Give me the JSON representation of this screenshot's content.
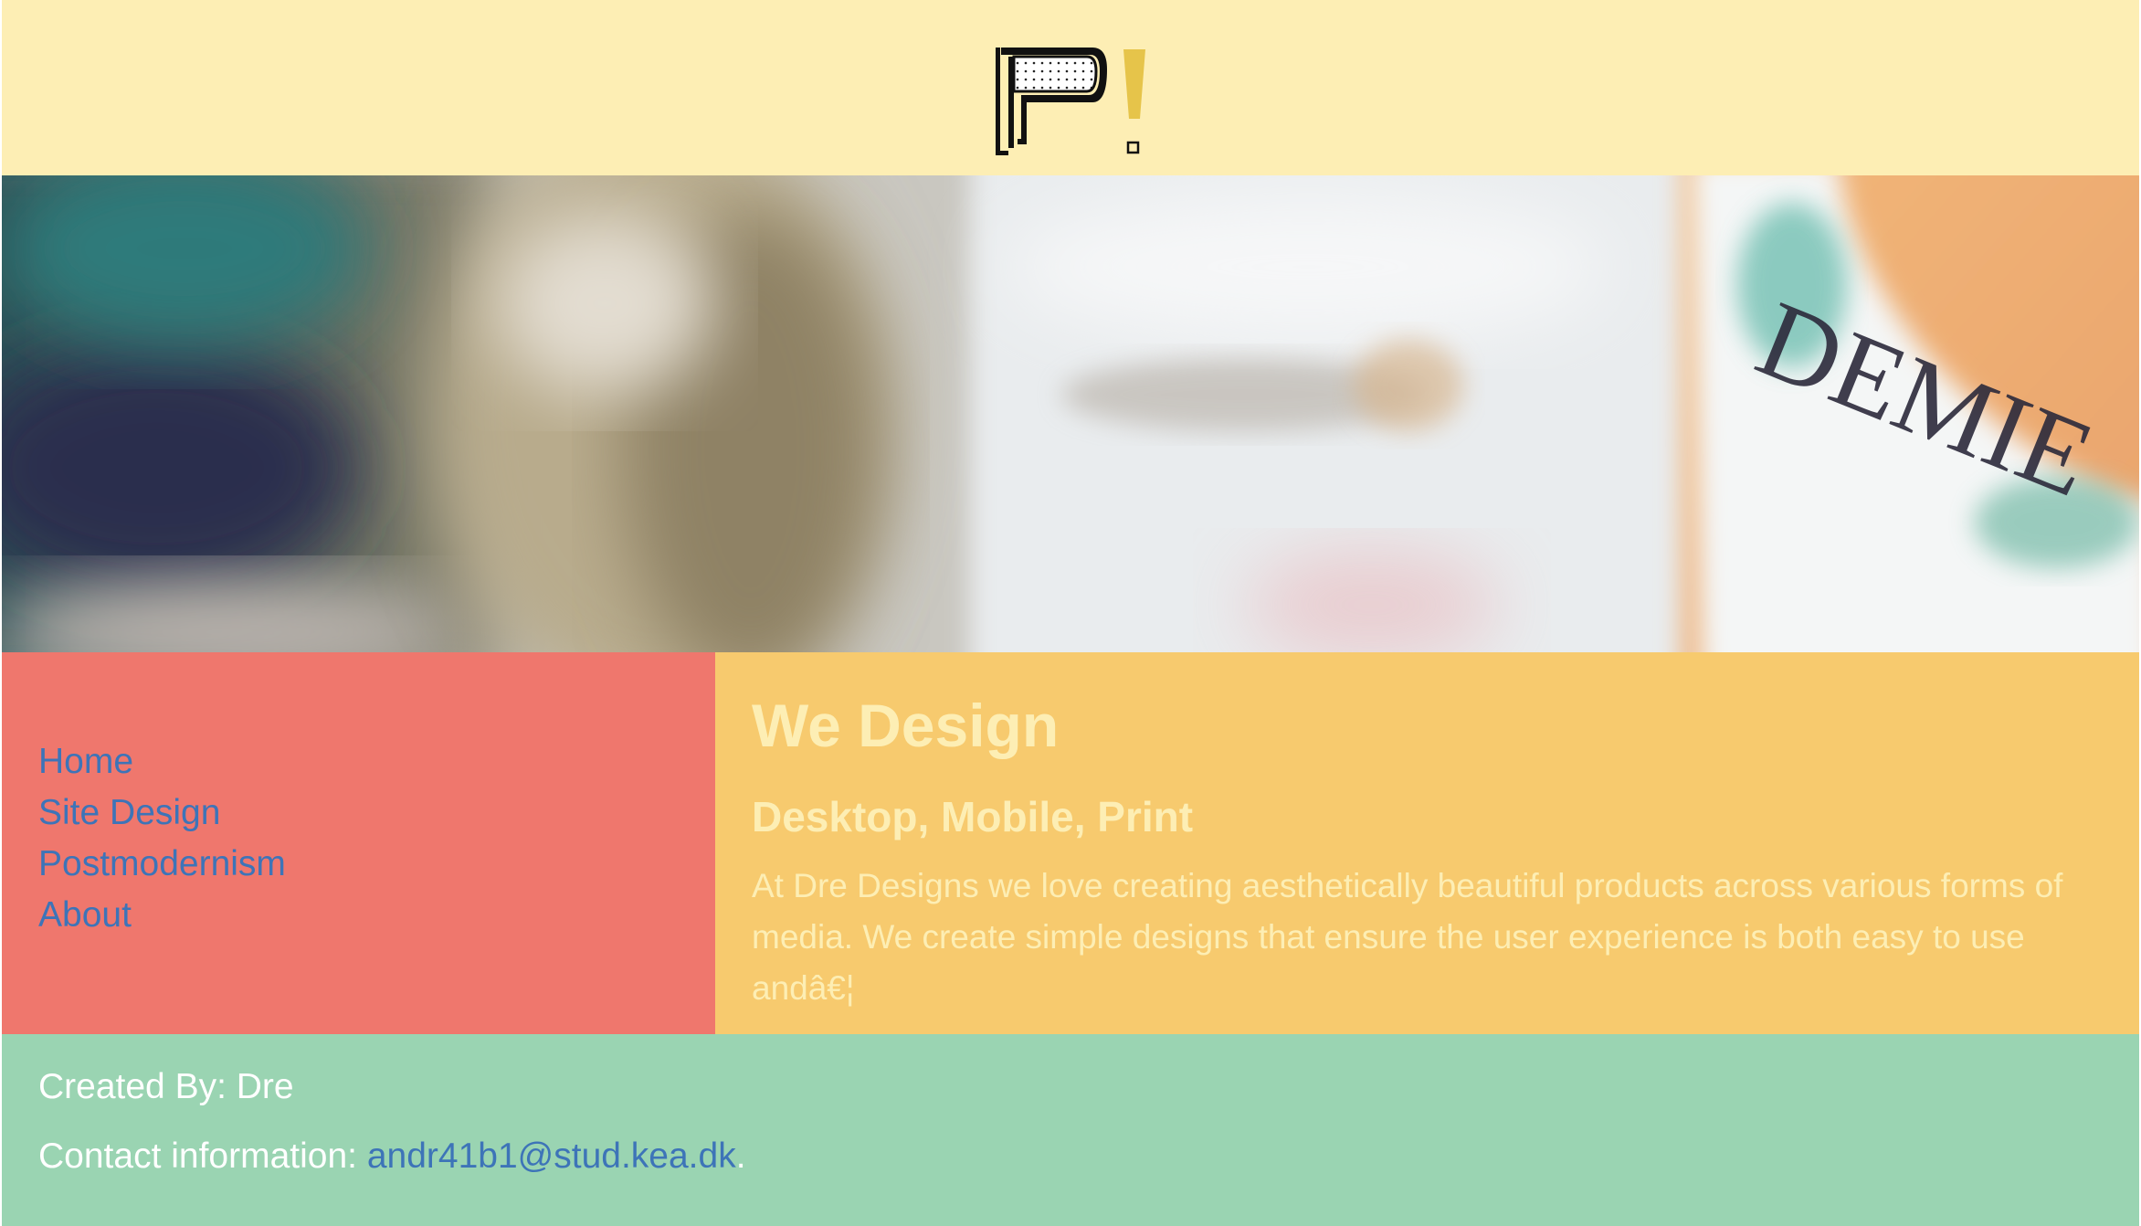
{
  "header": {
    "logo_icon": "flag-exclamation-logo-icon"
  },
  "hero": {
    "image": "blurred-cup-photo"
  },
  "nav": {
    "items": [
      {
        "label": "Home"
      },
      {
        "label": "Site Design"
      },
      {
        "label": "Postmodernism"
      },
      {
        "label": "About"
      }
    ]
  },
  "main": {
    "title": "We Design",
    "subtitle": "Desktop, Mobile, Print",
    "body": "At Dre Designs we love creating aesthetically beautiful products across various forms of media. We create simple designs that ensure the user experience is both easy to use andâ€¦"
  },
  "footer": {
    "created_by": "Created By: Dre",
    "contact_label": "Contact information: ",
    "contact_email": "andr41b1@stud.kea.dk",
    "contact_suffix": "."
  },
  "colors": {
    "header_bg": "#fdeeb4",
    "nav_bg": "#ef776d",
    "main_bg": "#f7ca6e",
    "footer_bg": "#9ad4b2",
    "link": "#3d74b8",
    "main_text": "#fdeeb4"
  }
}
